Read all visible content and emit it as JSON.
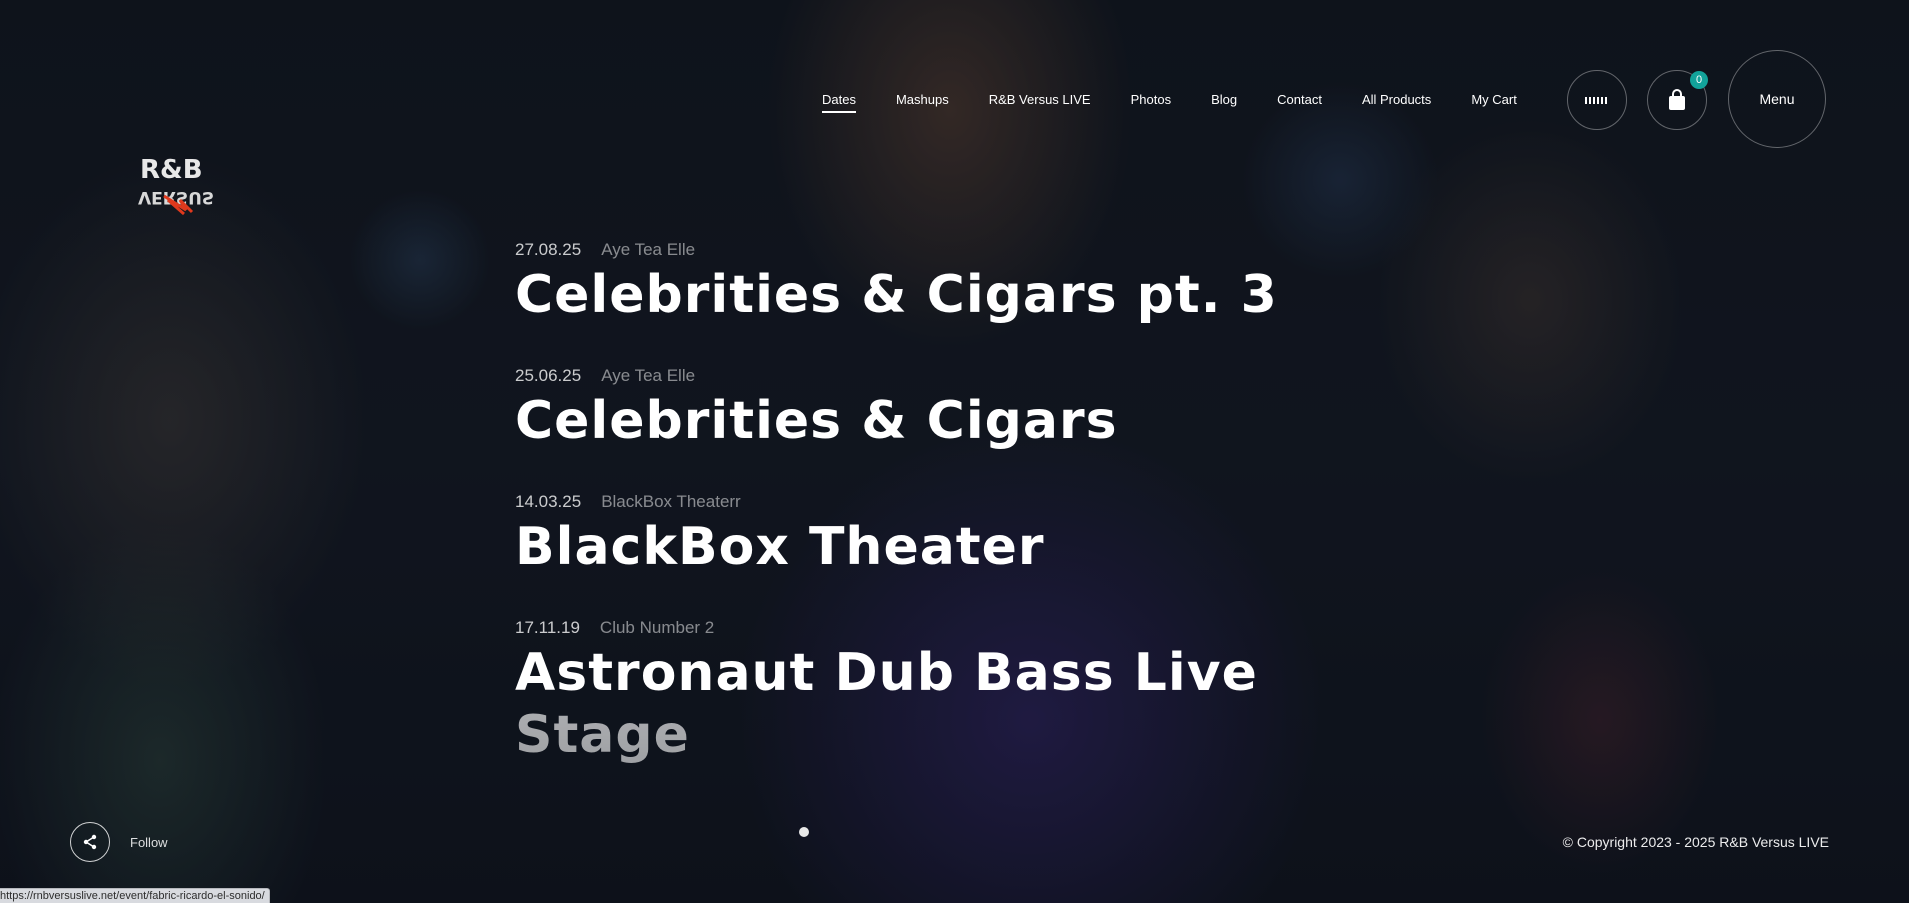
{
  "brand": {
    "logo_top": "R&B",
    "logo_bottom": "VERSUS"
  },
  "nav": {
    "items": [
      {
        "label": "Dates",
        "active": true
      },
      {
        "label": "Mashups"
      },
      {
        "label": "R&B Versus LIVE"
      },
      {
        "label": "Photos"
      },
      {
        "label": "Blog"
      },
      {
        "label": "Contact"
      },
      {
        "label": "All Products"
      },
      {
        "label": "My Cart"
      }
    ],
    "search_icon": "barcode-search-icon",
    "cart_icon": "shopping-bag-icon",
    "cart_count": "0",
    "menu_label": "Menu"
  },
  "events": [
    {
      "date": "27.08.25",
      "venue": "Aye Tea Elle",
      "title": "Celebrities & Cigars pt. 3"
    },
    {
      "date": "25.06.25",
      "venue": "Aye Tea Elle",
      "title": "Celebrities & Cigars"
    },
    {
      "date": "14.03.25",
      "venue": "BlackBox Theaterr",
      "title": "BlackBox Theater"
    },
    {
      "date": "17.11.19",
      "venue": "Club Number 2",
      "title": "Astronaut Dub Bass Live Stage"
    }
  ],
  "footer": {
    "follow_label": "Follow",
    "share_icon": "share-icon",
    "copyright": "© Copyright 2023 - 2025 R&B Versus LIVE"
  },
  "status_url": "https://rnbversuslive.net/event/fabric-ricardo-el-sonido/"
}
